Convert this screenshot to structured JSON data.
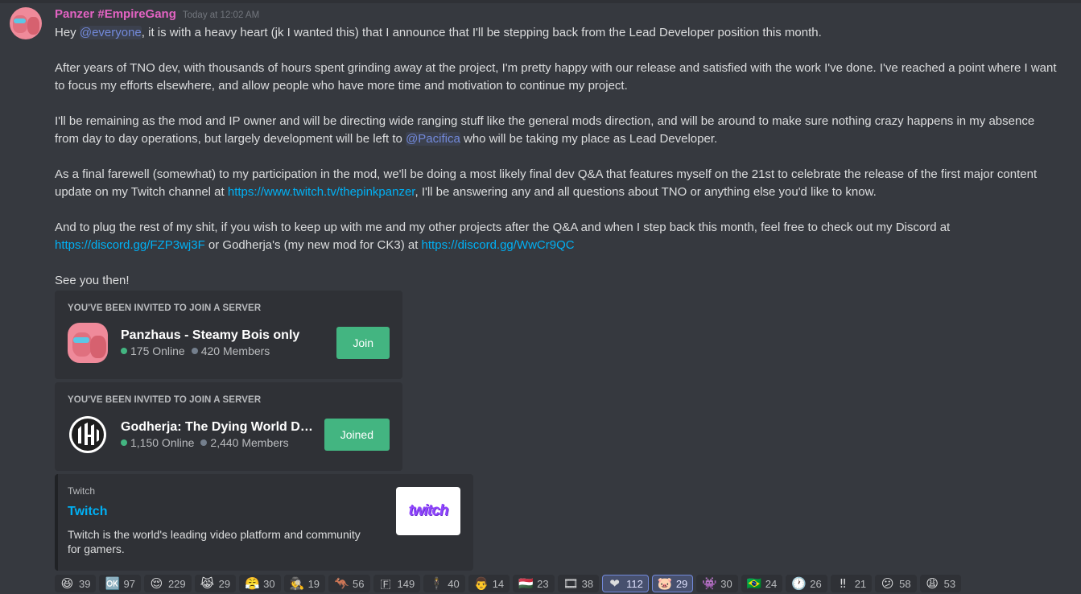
{
  "message": {
    "username": "Panzer #EmpireGang",
    "timestamp": "Today at 12:02 AM",
    "p1_pre": "Hey ",
    "p1_mention": "@everyone",
    "p1_post": ", it is with a heavy heart (jk I wanted this) that I announce that I'll be stepping back from the Lead Developer position this month.",
    "p2": "After years of TNO dev, with thousands of hours spent grinding away at the project, I'm pretty happy with our release and satisfied with the work I've done. I've reached a point where I want to focus my efforts elsewhere, and allow people who have more time and motivation to continue my project.",
    "p3_pre": "I'll be remaining as the mod and IP owner and will be directing wide ranging stuff like the general mods direction, and will be around to make sure nothing crazy happens in my absence from day to day operations, but largely development will be left to ",
    "p3_mention": "@Pacifica",
    "p3_post": " who will be taking my place as Lead Developer.",
    "p4_pre": "As a final farewell (somewhat) to my participation in the mod, we'll be doing a most likely final dev Q&A that features myself on the 21st to celebrate the release of the first major content update on my Twitch channel at ",
    "p4_link": "https://www.twitch.tv/thepinkpanzer",
    "p4_post": ", I'll be answering any and all questions about TNO or anything else you'd like to know.",
    "p5_pre": "And to plug the rest of my shit, if you wish to keep up with me and my other projects after the Q&A and when I step back this month, feel free to check out my Discord at ",
    "p5_link1": "https://discord.gg/FZP3wj3F",
    "p5_mid": " or Godherja's (my new mod for CK3) at ",
    "p5_link2": "https://discord.gg/WwCr9QC",
    "p6": "See you then!"
  },
  "invites": [
    {
      "title": "You've been invited to join a server",
      "server_name": "Panzhaus - Steamy Bois only",
      "online": "175 Online",
      "members": "420 Members",
      "button": "Join"
    },
    {
      "title": "You've been invited to join a server",
      "server_name": "Godherja: The Dying World Developer Server",
      "online": "1,150 Online",
      "members": "2,440 Members",
      "button": "Joined"
    }
  ],
  "embed": {
    "provider": "Twitch",
    "title": "Twitch",
    "description": "Twitch is the world's leading video platform and community for gamers.",
    "thumbnail_text": "twitch"
  },
  "reactions": [
    {
      "emoji": "😆",
      "icon": "laughing-icon",
      "count": "39",
      "me": false
    },
    {
      "emoji": "🆗",
      "icon": "ok-icon",
      "count": "97",
      "me": false
    },
    {
      "emoji": "😌",
      "icon": "relieved-icon",
      "count": "229",
      "me": false
    },
    {
      "emoji": "😹",
      "icon": "cat-joy-icon",
      "count": "29",
      "me": false
    },
    {
      "emoji": "😤",
      "icon": "triumph-icon",
      "count": "30",
      "me": false
    },
    {
      "emoji": "🕵",
      "icon": "detective-icon",
      "count": "19",
      "me": false
    },
    {
      "emoji": "🦘",
      "icon": "custom-emoji-1-icon",
      "count": "56",
      "me": false
    },
    {
      "emoji": "🇫",
      "icon": "letter-f-icon",
      "count": "149",
      "me": false
    },
    {
      "emoji": "🕴",
      "icon": "custom-emoji-2-icon",
      "count": "40",
      "me": false
    },
    {
      "emoji": "👨",
      "icon": "custom-emoji-3-icon",
      "count": "14",
      "me": false
    },
    {
      "emoji": "🇭🇺",
      "icon": "hungary-flag-icon",
      "count": "23",
      "me": false
    },
    {
      "emoji": "🎞",
      "icon": "custom-emoji-4-icon",
      "count": "38",
      "me": false
    },
    {
      "emoji": "❤",
      "icon": "heart-icon",
      "count": "112",
      "me": true
    },
    {
      "emoji": "🐷",
      "icon": "custom-pig-icon",
      "count": "29",
      "me": true
    },
    {
      "emoji": "👾",
      "icon": "custom-emoji-5-icon",
      "count": "30",
      "me": false
    },
    {
      "emoji": "🇧🇷",
      "icon": "brazil-flag-icon",
      "count": "24",
      "me": false
    },
    {
      "emoji": "🕐",
      "icon": "custom-emoji-6-icon",
      "count": "26",
      "me": false
    },
    {
      "emoji": "‼",
      "icon": "double-exclamation-icon",
      "count": "21",
      "me": false
    },
    {
      "emoji": "😕",
      "icon": "confused-icon",
      "count": "58",
      "me": false
    },
    {
      "emoji": "😩",
      "icon": "weary-icon",
      "count": "53",
      "me": false
    }
  ],
  "colors": {
    "background": "#36393f",
    "username": "#e363c3",
    "mention": "#7289da",
    "link": "#00b0f4",
    "join_button": "#43b581"
  }
}
